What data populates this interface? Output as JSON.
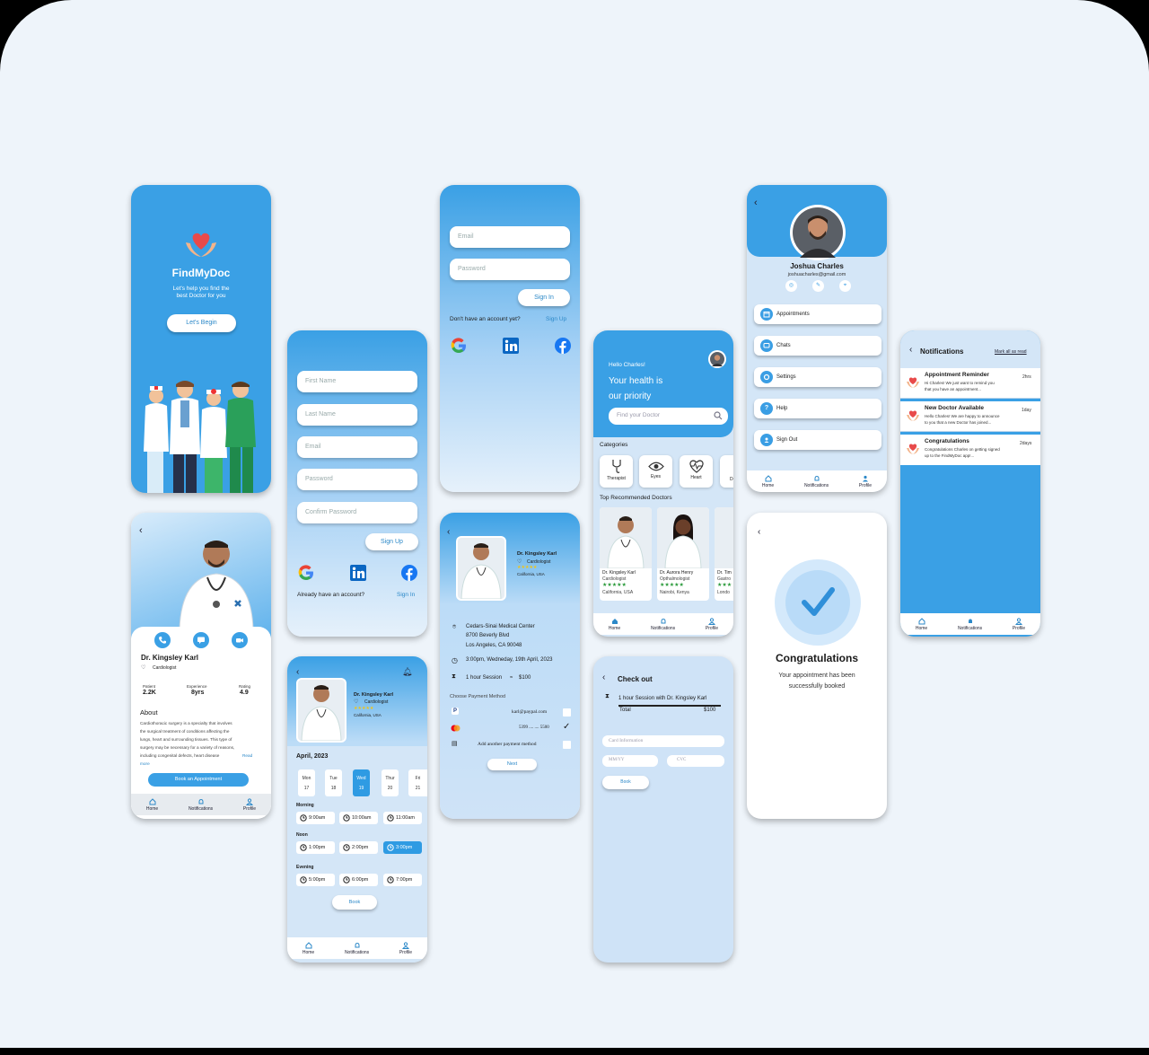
{
  "welcome": {
    "app_name": "FindMyDoc",
    "tagline_1": "Let's help you find the",
    "tagline_2": "best Doctor for you",
    "begin": "Let's Begin"
  },
  "signup": {
    "first_name": "First Name",
    "last_name": "Last Name",
    "email": "Email",
    "password": "Password",
    "confirm": "Confirm Password",
    "button": "Sign Up",
    "have_account": "Already have an account?",
    "signin": "Sign In"
  },
  "signin": {
    "email": "Email",
    "password": "Password",
    "button": "Sign In",
    "no_account": "Don't have an account yet?",
    "signup": "Sign Up"
  },
  "profile": {
    "name": "Joshua Charles",
    "email": "joshuacharles@gmail.com",
    "menu": [
      "Appointments",
      "Chats",
      "Settings",
      "Help",
      "Sign Out"
    ]
  },
  "nav": {
    "home": "Home",
    "notifications": "Notifications",
    "profile": "Profile"
  },
  "home": {
    "greeting": "Hello Charles!",
    "headline_1": "Your health is",
    "headline_2": "our priority",
    "search_placeholder": "Find your Doctor",
    "categories_title": "Categories",
    "categories": [
      "Therapist",
      "Eyes",
      "Heart",
      "De"
    ],
    "recommended_title": "Top Recommended Doctors",
    "doctors": [
      {
        "name": "Dr. Kingsley Karl",
        "role": "Cardiologist",
        "loc": "California, USA"
      },
      {
        "name": "Dr. Aurora Henry",
        "role": "Opthalmologist",
        "loc": "Nairobi, Kenya"
      },
      {
        "name": "Dr. Tim",
        "role": "Gastro",
        "loc": "Londo"
      }
    ]
  },
  "notifications": {
    "title": "Notifications",
    "mark_all": "Mark all as read",
    "items": [
      {
        "title": "Appointment Reminder",
        "body_1": "Hi Charles! We just want to remind you",
        "body_2": "that you have an appointment...",
        "time": "2hrs"
      },
      {
        "title": "New Doctor Available",
        "body_1": "Hello Charles! We are happy to announce",
        "body_2": "to you that a new Doctor has joined...",
        "time": "1day"
      },
      {
        "title": "Congratulations",
        "body_1": "Congratulations Charles on getting signed",
        "body_2": "up to the FindMyDoc app!...",
        "time": "2days"
      }
    ]
  },
  "doctor_detail": {
    "name": "Dr. Kingsley Karl",
    "role": "Cardiologist",
    "stats": [
      {
        "label": "Patient",
        "value": "2.2K"
      },
      {
        "label": "Experience",
        "value": "8yrs"
      },
      {
        "label": "Rating",
        "value": "4.9"
      }
    ],
    "about_title": "About",
    "about_lines": [
      "Cardiothoracic surgery is a specialty that involves",
      "the surgical treatment of conditions affecting the",
      "lungs, heart and surrounding tissues. This type of",
      "surgery may be necessary for a variety of reasons,",
      "including congenital defects, heart disease"
    ],
    "read_more_1": "Read",
    "read_more_2": "more",
    "book": "Book an Appointment"
  },
  "payment": {
    "doctor": "Dr. Kingsley Karl",
    "role": "Cardiologist",
    "loc": "California, USA",
    "hospital": "Cedars-Sinai Medical Center",
    "address_1": "8700 Beverly Blvd",
    "address_2": "Los Angeles, CA 90048",
    "datetime": "3:00pm, Wedneday, 19th April, 2023",
    "session": "1 hour Session",
    "price": "$100",
    "approx": "≈",
    "method_title": "Choose Payment Method",
    "paypal": "karl@paypal.com",
    "card": "5399 .... .... 5500",
    "add": "Add another payment method",
    "next": "Next"
  },
  "schedule": {
    "doctor": "Dr. Kingsley Karl",
    "role": "Cardiologist",
    "loc": "California, USA",
    "month": "April, 2023",
    "days": [
      {
        "d": "Mon",
        "n": "17"
      },
      {
        "d": "Tue",
        "n": "18"
      },
      {
        "d": "Wed",
        "n": "19"
      },
      {
        "d": "Thur",
        "n": "20"
      },
      {
        "d": "Fri",
        "n": "21"
      }
    ],
    "morning": "Morning",
    "noon": "Noon",
    "evening": "Evening",
    "slots_morning": [
      "9:00am",
      "10:00am",
      "11:00am"
    ],
    "slots_noon": [
      "1:00pm",
      "2:00pm",
      "3:00pm"
    ],
    "slots_evening": [
      "5:00pm",
      "6:00pm",
      "7:00pm"
    ],
    "book": "Book"
  },
  "checkout": {
    "title": "Check out",
    "line": "1 hour Session with Dr. Kingsley Karl",
    "total_label": "Total",
    "total": "$100",
    "card_info": "Card Information",
    "mmyy": "MM/YY",
    "cvc": "CVC",
    "book": "Book"
  },
  "congrats": {
    "title": "Congratulations",
    "msg_1": "Your appointment has been",
    "msg_2": "successfully booked"
  },
  "colors": {
    "primary": "#38a0e6",
    "light": "#cfe3f7",
    "star": "#f0c419"
  }
}
